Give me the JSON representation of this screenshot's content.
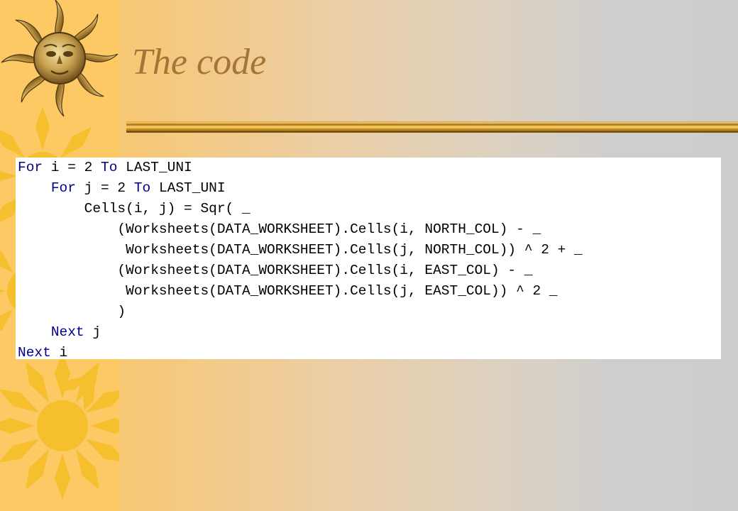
{
  "slide": {
    "title": "The code"
  },
  "code": {
    "lines": [
      [
        {
          "k": true,
          "t": "For"
        },
        {
          "t": " i = 2 "
        },
        {
          "k": true,
          "t": "To"
        },
        {
          "t": " LAST_UNI"
        }
      ],
      [
        {
          "t": "    "
        },
        {
          "k": true,
          "t": "For"
        },
        {
          "t": " j = 2 "
        },
        {
          "k": true,
          "t": "To"
        },
        {
          "t": " LAST_UNI"
        }
      ],
      [
        {
          "t": "        Cells(i, j) = Sqr( _"
        }
      ],
      [
        {
          "t": "            (Worksheets(DATA_WORKSHEET).Cells(i, NORTH_COL) - _"
        }
      ],
      [
        {
          "t": "             Worksheets(DATA_WORKSHEET).Cells(j, NORTH_COL)) ^ 2 + _"
        }
      ],
      [
        {
          "t": "            (Worksheets(DATA_WORKSHEET).Cells(i, EAST_COL) - _"
        }
      ],
      [
        {
          "t": "             Worksheets(DATA_WORKSHEET).Cells(j, EAST_COL)) ^ 2 _"
        }
      ],
      [
        {
          "t": "            )"
        }
      ],
      [
        {
          "t": "    "
        },
        {
          "k": true,
          "t": "Next"
        },
        {
          "t": " j"
        }
      ],
      [
        {
          "k": true,
          "t": "Next"
        },
        {
          "t": " i"
        }
      ]
    ]
  },
  "colors": {
    "title": "#a5743a",
    "keyword": "#00008b",
    "sun": "#f5bf2e",
    "left_strip": "#fcc965",
    "background": "#cdcdcd"
  },
  "icons": [
    "golden-face-sun-icon",
    "sun-icon",
    "sun-icon",
    "sun-icon",
    "sun-icon"
  ]
}
